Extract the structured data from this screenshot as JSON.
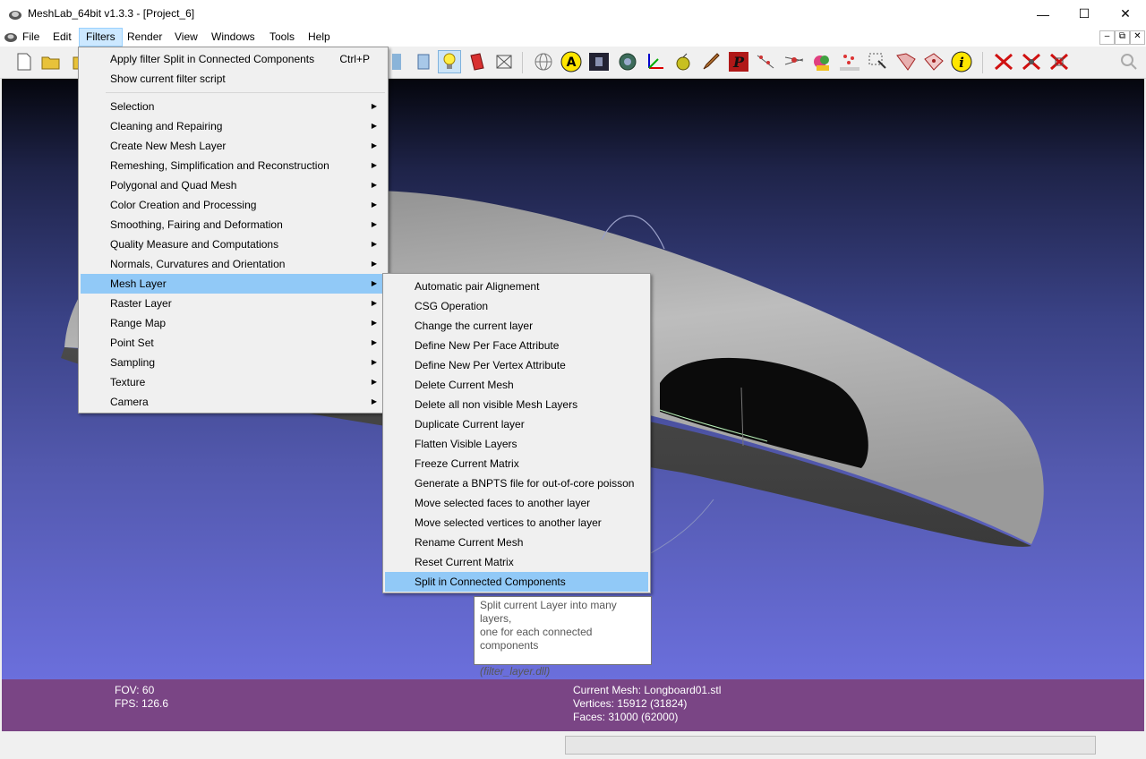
{
  "window": {
    "title": "MeshLab_64bit v1.3.3 - [Project_6]",
    "minimize": "—",
    "maximize": "☐",
    "close": "✕"
  },
  "menubar": {
    "items": [
      "File",
      "Edit",
      "Filters",
      "Render",
      "View",
      "Windows",
      "Tools",
      "Help"
    ],
    "active": "Filters",
    "mdi_buttons": [
      "–",
      "⧉",
      "✕"
    ]
  },
  "filters_menu": {
    "top_items": [
      {
        "label": "Apply filter Split in Connected Components",
        "shortcut": "Ctrl+P"
      },
      {
        "label": "Show current filter script",
        "shortcut": ""
      }
    ],
    "submenus": [
      "Selection",
      "Cleaning and Repairing",
      "Create New Mesh Layer",
      "Remeshing, Simplification and Reconstruction",
      "Polygonal and Quad Mesh",
      "Color Creation and Processing",
      "Smoothing, Fairing and Deformation",
      "Quality Measure and Computations",
      "Normals, Curvatures and Orientation",
      "Mesh Layer",
      "Raster Layer",
      "Range Map",
      "Point Set",
      "Sampling",
      "Texture",
      "Camera"
    ],
    "highlighted": "Mesh Layer",
    "arrow": "▶"
  },
  "mesh_layer_menu": {
    "items": [
      "Automatic pair Alignement",
      "CSG Operation",
      "Change the current layer",
      "Define New Per Face Attribute",
      "Define New Per Vertex Attribute",
      "Delete Current Mesh",
      "Delete all non visible Mesh Layers",
      "Duplicate Current layer",
      "Flatten Visible Layers",
      "Freeze Current Matrix",
      "Generate a BNPTS file for out-of-core poisson",
      "Move selected faces to another layer",
      "Move selected vertices to another layer",
      "Rename Current Mesh",
      "Reset Current Matrix",
      "Split in Connected Components"
    ],
    "highlighted": "Split in Connected Components"
  },
  "tooltip": {
    "line1": "Split current Layer into many layers,",
    "line2": "one for each connected",
    "line3": "components",
    "dll": "(filter_layer.dll)"
  },
  "info": {
    "fov": "FOV: 60",
    "fps": "FPS:   126.6",
    "current_mesh": "Current Mesh: Longboard01.stl",
    "vertices": "Vertices: 15912 (31824)",
    "faces": "Faces: 31000 (62000)"
  },
  "toolbar_icons": [
    "new-file-icon",
    "open-icon",
    "open-project-icon",
    "layer-icon",
    "lamp-icon",
    "paint-icon",
    "bbox-icon",
    "sphere-icon",
    "annotation-icon",
    "texture-icon",
    "nut-icon",
    "axis-icon",
    "apple-icon",
    "brush-icon",
    "pick-icon",
    "point-icon",
    "align-icon",
    "shape-icon",
    "reference-icon",
    "select-icon",
    "select-faces-icon",
    "select-vertices-icon",
    "info-icon",
    "delete-faces-icon",
    "delete-vertices-icon",
    "delete-all-icon",
    "search-icon"
  ],
  "colors": {
    "menu_highlight": "#91c9f7",
    "info_bar": "#7a4585",
    "viewport_top": "#05060d",
    "viewport_bottom": "#6b6fdc"
  }
}
